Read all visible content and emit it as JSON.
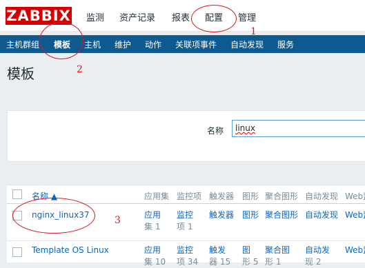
{
  "logo": {
    "text": "ZABBIX",
    "color": "#d40000"
  },
  "top_menu": [
    "监测",
    "资产记录",
    "报表",
    "配置",
    "管理"
  ],
  "sub_menu": {
    "items": [
      "主机群组",
      "模板",
      "主机",
      "维护",
      "动作",
      "关联项事件",
      "自动发现",
      "服务"
    ],
    "active": "模板",
    "bg_color": "#0e5a8e"
  },
  "page_title": "模板",
  "filter": {
    "label": "名称",
    "value": "linux"
  },
  "table": {
    "headers": [
      "名称 ▲",
      "应用集",
      "监控项",
      "触发器",
      "图形",
      "聚合图形",
      "自动发现",
      "Web监"
    ],
    "rows": [
      {
        "name": "nginx_linux37",
        "apps": [
          "应用",
          "集 1"
        ],
        "items": [
          "监控",
          "项 1"
        ],
        "triggers": [
          "触发器"
        ],
        "graphs": [
          "图形"
        ],
        "screens": [
          "聚合图形"
        ],
        "discovery": [
          "自动发现"
        ],
        "web": "Web监"
      },
      {
        "name": "Template OS Linux",
        "apps": [
          "应用",
          "集 10"
        ],
        "items": [
          "监控",
          "项 34"
        ],
        "triggers": [
          "触发",
          "器 15"
        ],
        "graphs": [
          "图",
          "形 5"
        ],
        "screens": [
          "聚合图",
          "形 1"
        ],
        "discovery": [
          "自动发",
          "现 2"
        ],
        "web": "Web监"
      }
    ]
  },
  "annotations": [
    "1",
    "2",
    "3"
  ],
  "colors": {
    "link": "#0a66c2",
    "annotation": "#e0141e",
    "filter_border": "#5b9ed4"
  }
}
